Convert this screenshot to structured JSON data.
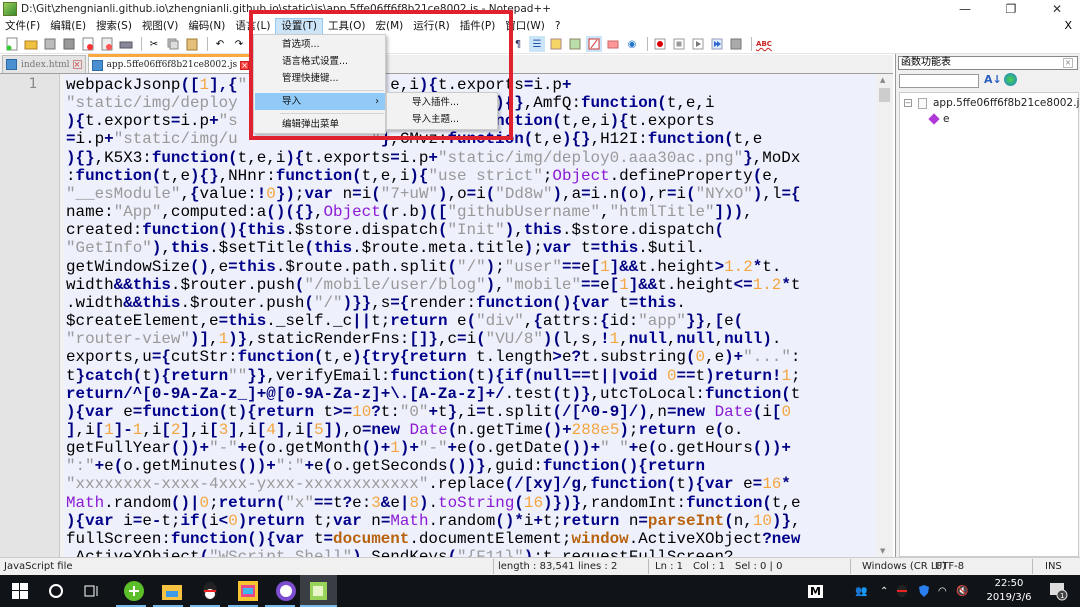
{
  "window": {
    "title": "D:\\Git\\zhengnianli.github.io\\zhengnianli.github.io\\static\\js\\app.5ffe06ff6f8b21ce8002.js - Notepad++",
    "minimize": "—",
    "restore": "❐",
    "close": "✕"
  },
  "menubar": {
    "items": [
      "文件(F)",
      "编辑(E)",
      "搜索(S)",
      "视图(V)",
      "编码(N)",
      "语言(L)",
      "设置(T)",
      "工具(O)",
      "宏(M)",
      "运行(R)",
      "插件(P)",
      "窗口(W)",
      "?"
    ],
    "active": "设置(T)",
    "doc_close": "X"
  },
  "settings_menu": {
    "items": [
      "首选项...",
      "语言格式设置...",
      "管理快捷键...",
      "导入",
      "编辑弹出菜单"
    ],
    "highlighted": "导入",
    "submenu_arrow": "›",
    "import_submenu": [
      "导入插件...",
      "导入主题..."
    ]
  },
  "tabs": [
    {
      "label": "index.html",
      "active": false
    },
    {
      "label": "app.5ffe06ff6f8b21ce8002.js",
      "active": true
    }
  ],
  "editor": {
    "line_number": "1"
  },
  "function_list": {
    "title": "函数功能表",
    "close": "×",
    "search_value": "",
    "sort_icon": "A↓Z",
    "root": "app.5ffe06ff6f8b21ce8002.js",
    "children": [
      "e"
    ],
    "expand": "−"
  },
  "statusbar": {
    "filetype": "JavaScript file",
    "length": "length : 83,541",
    "lines": "lines : 2",
    "ln": "Ln : 1",
    "col": "Col : 1",
    "sel": "Sel : 0 | 0",
    "eol": "Windows (CR LF)",
    "encoding": "UTF-8",
    "mode": "INS"
  },
  "taskbar": {
    "ime": "M",
    "time": "22:50",
    "date": "2019/3/6",
    "notifications": "1"
  },
  "colors": {
    "highlight_box": "#e0222e",
    "keyword": "#00008b",
    "string": "#999999",
    "number": "#f5a540",
    "editor_bg": "#eef0fc"
  }
}
